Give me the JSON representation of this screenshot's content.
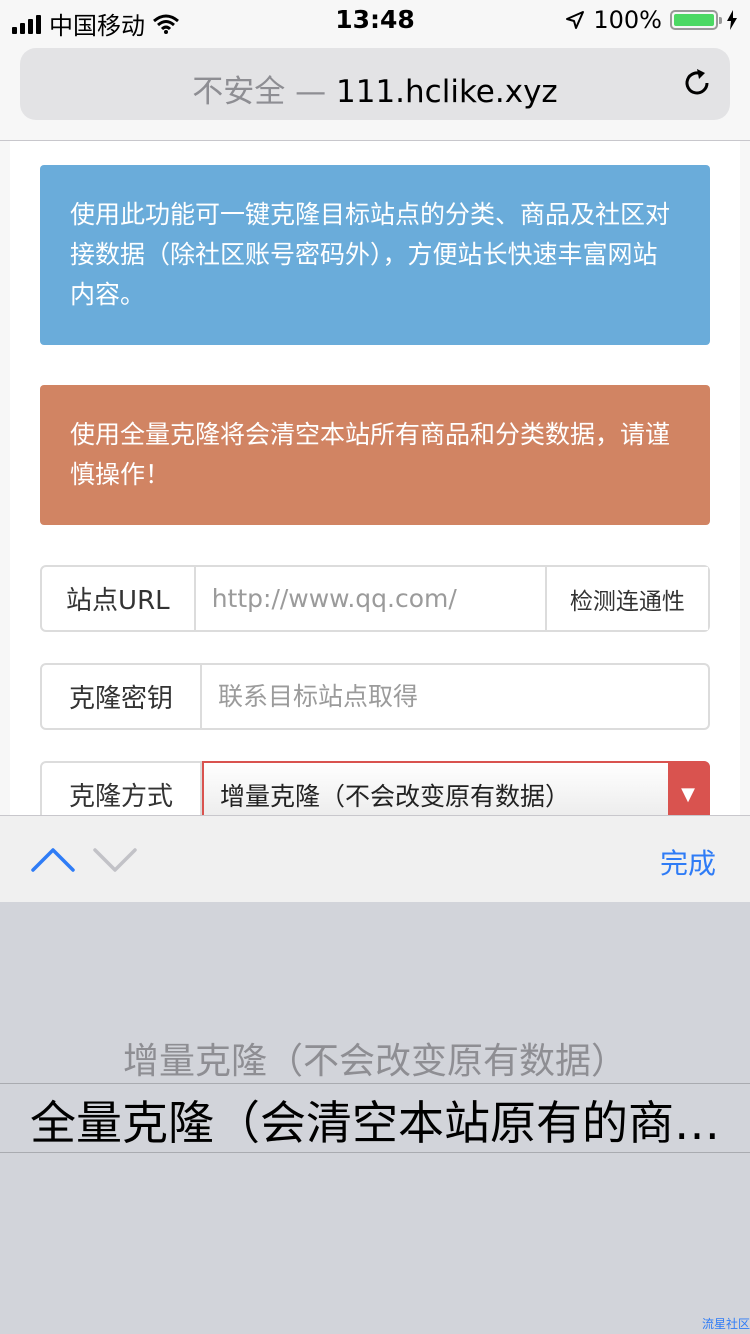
{
  "status_bar": {
    "carrier": "中国移动",
    "time": "13:48",
    "battery_text": "100%",
    "battery_level": 1.0,
    "battery_color": "#4cd964"
  },
  "browser": {
    "insecure_label": "不安全 —",
    "host": "111.hclike.xyz",
    "reload_icon": "reload-icon"
  },
  "alerts": {
    "info": "使用此功能可一键克隆目标站点的分类、商品及社区对接数据（除社区账号密码外），方便站长快速丰富网站内容。",
    "warning": "使用全量克隆将会清空本站所有商品和分类数据，请谨慎操作！",
    "info_color": "#6aacda",
    "warning_color": "#d18463"
  },
  "form": {
    "site_url_label": "站点URL",
    "site_url_placeholder": "http://www.qq.com/",
    "site_url_value": "",
    "check_button": "检测连通性",
    "key_label": "克隆密钥",
    "key_placeholder": "联系目标站点取得",
    "key_value": "",
    "mode_label": "克隆方式",
    "mode_selected": "增量克隆（不会改变原有数据）",
    "mode_arrow": "▼"
  },
  "keyboard_toolbar": {
    "done_label": "完成",
    "done_color": "#2f7cf6"
  },
  "picker": {
    "options": [
      "增量克隆（不会改变原有数据）",
      "全量克隆（会清空本站原有的商…"
    ],
    "selected_index": 1
  },
  "watermark": "流星社区"
}
